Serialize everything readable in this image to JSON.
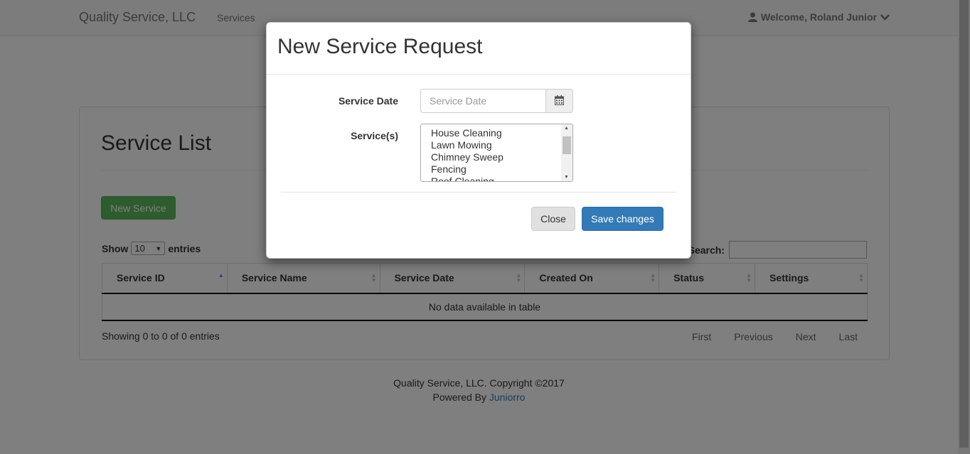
{
  "navbar": {
    "brand": "Quality Service, LLC",
    "services_link": "Services",
    "user_greeting": "Welcome, Roland Junior"
  },
  "main": {
    "title": "Service List",
    "new_service_button": "New Service",
    "length": {
      "prefix": "Show",
      "value": "10",
      "suffix": "entries"
    },
    "search_label": "Search:",
    "search_value": "",
    "table": {
      "columns": [
        "Service ID",
        "Service Name",
        "Service Date",
        "Created On",
        "Status",
        "Settings"
      ],
      "sorted_column": "Service ID",
      "empty_message": "No data available in table"
    },
    "info": "Showing 0 to 0 of 0 entries",
    "pagination": [
      "First",
      "Previous",
      "Next",
      "Last"
    ]
  },
  "footer": {
    "copyright": "Quality Service, LLC. Copyright ©2017",
    "powered_prefix": "Powered By ",
    "powered_link": "Juniorro"
  },
  "modal": {
    "title": "New Service Request",
    "service_date_label": "Service Date",
    "service_date_placeholder": "Service Date",
    "services_label": "Service(s)",
    "services_options": [
      "House Cleaning",
      "Lawn Mowing",
      "Chimney Sweep",
      "Fencing",
      "Roof Cleaning"
    ],
    "close_button": "Close",
    "save_button": "Save changes"
  },
  "colors": {
    "primary": "#337ab7",
    "success": "#5cb85c",
    "backdrop": "rgba(0,0,0,0.5)"
  },
  "icons": {
    "user": "user-icon",
    "chevron": "chevron-down-icon",
    "calendar": "calendar-icon",
    "sort": "sort-icon"
  }
}
